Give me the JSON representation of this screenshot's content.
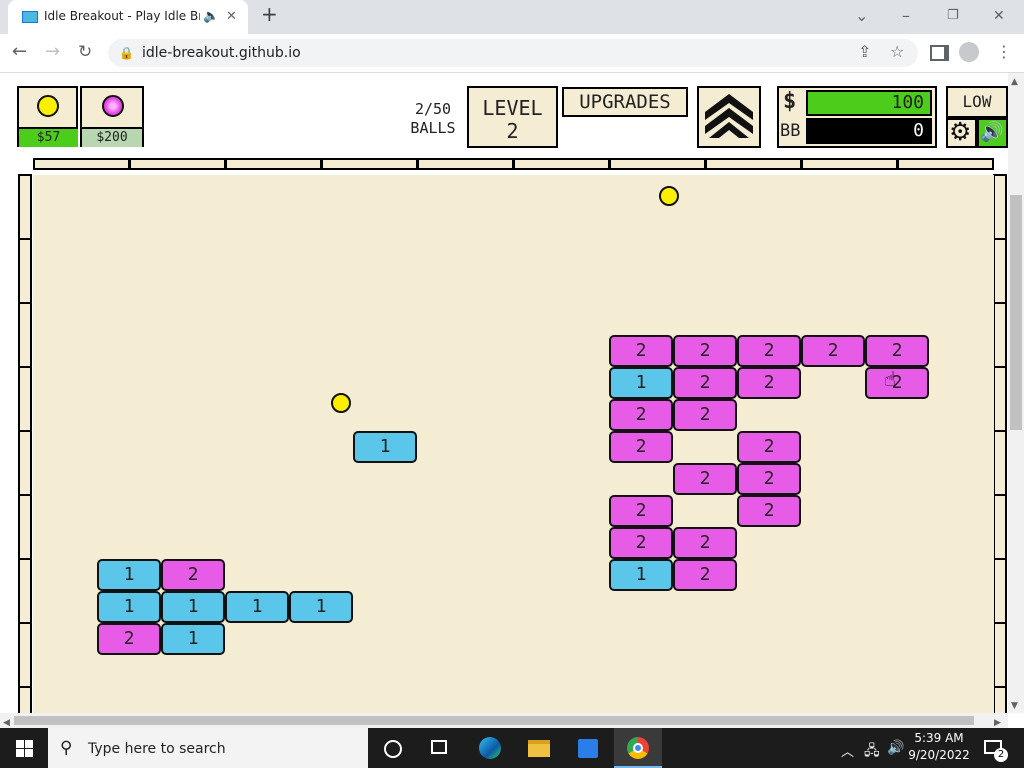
{
  "browser": {
    "tab_title": "Idle Breakout - Play Idle Brea",
    "new_tab": "+",
    "url": "idle-breakout.github.io",
    "window_controls": {
      "minimize": "–",
      "maximize": "❐",
      "close": "✕"
    }
  },
  "game": {
    "ball_shop": [
      {
        "price": "$57",
        "ball_color": "#fbef00"
      },
      {
        "price": "$200",
        "ball_color": "#e546e5"
      }
    ],
    "balls_count": "2/50",
    "balls_label": "BALLS",
    "level_label": "LEVEL",
    "level_value": "2",
    "upgrades_label": "UPGRADES",
    "money_symbol": "$",
    "money_value": "100",
    "bb_symbol": "BB",
    "bb_value": "0",
    "quality_label": "LOW",
    "bricks": [
      {
        "label": "2",
        "type": 2,
        "col": 9,
        "row": 5
      },
      {
        "label": "2",
        "type": 2,
        "col": 10,
        "row": 5
      },
      {
        "label": "2",
        "type": 2,
        "col": 11,
        "row": 5
      },
      {
        "label": "2",
        "type": 2,
        "col": 12,
        "row": 5
      },
      {
        "label": "2",
        "type": 2,
        "col": 13,
        "row": 5
      },
      {
        "label": "1",
        "type": 1,
        "col": 9,
        "row": 6
      },
      {
        "label": "2",
        "type": 2,
        "col": 10,
        "row": 6
      },
      {
        "label": "2",
        "type": 2,
        "col": 11,
        "row": 6
      },
      {
        "label": "2",
        "type": 2,
        "col": 13,
        "row": 6
      },
      {
        "label": "2",
        "type": 2,
        "col": 9,
        "row": 7
      },
      {
        "label": "2",
        "type": 2,
        "col": 10,
        "row": 7
      },
      {
        "label": "1",
        "type": 1,
        "col": 5,
        "row": 8
      },
      {
        "label": "2",
        "type": 2,
        "col": 9,
        "row": 8
      },
      {
        "label": "2",
        "type": 2,
        "col": 11,
        "row": 8
      },
      {
        "label": "2",
        "type": 2,
        "col": 10,
        "row": 9
      },
      {
        "label": "2",
        "type": 2,
        "col": 11,
        "row": 9
      },
      {
        "label": "2",
        "type": 2,
        "col": 9,
        "row": 10
      },
      {
        "label": "2",
        "type": 2,
        "col": 11,
        "row": 10
      },
      {
        "label": "2",
        "type": 2,
        "col": 9,
        "row": 11
      },
      {
        "label": "2",
        "type": 2,
        "col": 10,
        "row": 11
      },
      {
        "label": "1",
        "type": 1,
        "col": 1,
        "row": 12
      },
      {
        "label": "2",
        "type": 2,
        "col": 2,
        "row": 12
      },
      {
        "label": "1",
        "type": 1,
        "col": 9,
        "row": 12
      },
      {
        "label": "2",
        "type": 2,
        "col": 10,
        "row": 12
      },
      {
        "label": "1",
        "type": 1,
        "col": 1,
        "row": 13
      },
      {
        "label": "1",
        "type": 1,
        "col": 2,
        "row": 13
      },
      {
        "label": "1",
        "type": 1,
        "col": 3,
        "row": 13
      },
      {
        "label": "1",
        "type": 1,
        "col": 4,
        "row": 13
      },
      {
        "label": "2",
        "type": 2,
        "col": 1,
        "row": 14
      },
      {
        "label": "1",
        "type": 1,
        "col": 2,
        "row": 14
      }
    ],
    "brick_colors": {
      "1": "#5ac7ea",
      "2": "#e65ce6"
    }
  },
  "taskbar": {
    "search_placeholder": "Type here to search",
    "time": "5:39 AM",
    "date": "9/20/2022",
    "notification_count": "2"
  }
}
